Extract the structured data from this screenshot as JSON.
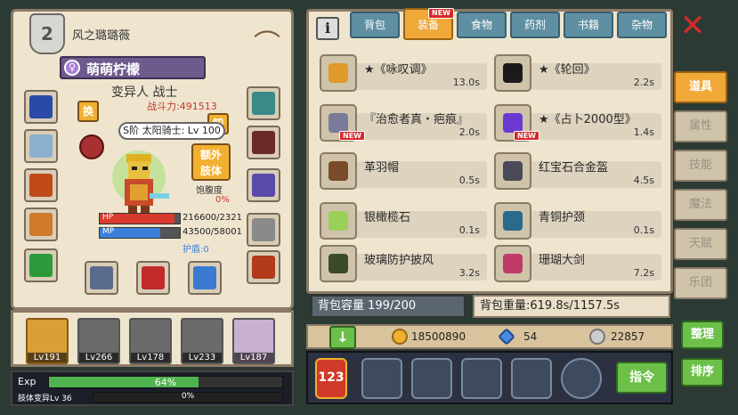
{
  "player": {
    "guild_name": "风之璐璐薇",
    "name": "萌萌柠檬",
    "gender_icon": "female-icon",
    "race_class": "变异人 战士",
    "combat_power": "战斗力:491513",
    "skill_tag": "S阶 太阳骑士: Lv 100",
    "swap_label": "换",
    "unload_label": "卸",
    "extra_limb_label": "额外\n肢体",
    "hunger_label": "饱腹度",
    "hunger_value": "0%",
    "hp_label": "HP",
    "hp_value": "216600/2321",
    "hp_fraction": 0.93,
    "mp_label": "MP",
    "mp_value": "43500/58001",
    "mp_fraction": 0.75,
    "shield": "护盾:0"
  },
  "party": [
    {
      "level": "Lv191",
      "active": true
    },
    {
      "level": "Lv266",
      "active": false
    },
    {
      "level": "Lv178",
      "active": false
    },
    {
      "level": "Lv233",
      "active": false
    },
    {
      "level": "Lv187",
      "active": false
    }
  ],
  "exp": {
    "label": "Exp",
    "percent": "64%",
    "fraction": 0.64,
    "mutation_label": "肢体变异Lv 36",
    "mutation_percent": "0%"
  },
  "tabs": [
    {
      "label": "背包",
      "active": false,
      "new": false
    },
    {
      "label": "装备",
      "active": true,
      "new": true,
      "new_label": "NEW"
    },
    {
      "label": "食物",
      "active": false,
      "new": false
    },
    {
      "label": "药剂",
      "active": false,
      "new": false
    },
    {
      "label": "书籍",
      "active": false,
      "new": false
    },
    {
      "label": "杂物",
      "active": false,
      "new": false
    }
  ],
  "items": [
    {
      "name": "★《咏叹调》",
      "time": "13.0s",
      "icon_color": "#e09a2a",
      "new": false
    },
    {
      "name": "★《轮回》",
      "time": "2.2s",
      "icon_color": "#1a1a1a",
      "new": false
    },
    {
      "name": "『治愈者真・疤痕』",
      "time": "2.0s",
      "icon_color": "#7a7a9a",
      "new": true
    },
    {
      "name": "★《占卜2000型》",
      "time": "1.4s",
      "icon_color": "#6a3ad0",
      "new": true
    },
    {
      "name": "革羽帽",
      "time": "0.5s",
      "icon_color": "#7a4a2a",
      "new": false
    },
    {
      "name": "红宝石合金盔",
      "time": "4.5s",
      "icon_color": "#4a4a5a",
      "new": false
    },
    {
      "name": "银橄榄石",
      "time": "0.1s",
      "icon_color": "#9ad05a",
      "new": false
    },
    {
      "name": "青铜护颈",
      "time": "0.1s",
      "icon_color": "#2a6a8a",
      "new": false
    },
    {
      "name": "玻璃防护披风",
      "time": "3.2s",
      "icon_color": "#3a4a2a",
      "new": false
    },
    {
      "name": "珊瑚大剑",
      "time": "7.2s",
      "icon_color": "#c03a6a",
      "new": false
    }
  ],
  "item_new_label": "NEW",
  "backpack": {
    "capacity": "背包容量 199/200",
    "weight": "背包重量:619.8s/1157.5s"
  },
  "currency": {
    "gold": "18500890",
    "gems": "54",
    "silver": "22857"
  },
  "side_tabs": [
    {
      "label": "道具",
      "active": true
    },
    {
      "label": "属性",
      "active": false
    },
    {
      "label": "技能",
      "active": false
    },
    {
      "label": "魔法",
      "active": false
    },
    {
      "label": "天赋",
      "active": false
    },
    {
      "label": "乐团",
      "active": false
    }
  ],
  "buttons": {
    "sort": "整理",
    "order": "排序",
    "command": "指令",
    "info": "i"
  },
  "colors": {
    "panel": "#efe5cf",
    "accent": "#f0a838",
    "tab_blue": "#5e8fa3",
    "green": "#6cc04a"
  }
}
